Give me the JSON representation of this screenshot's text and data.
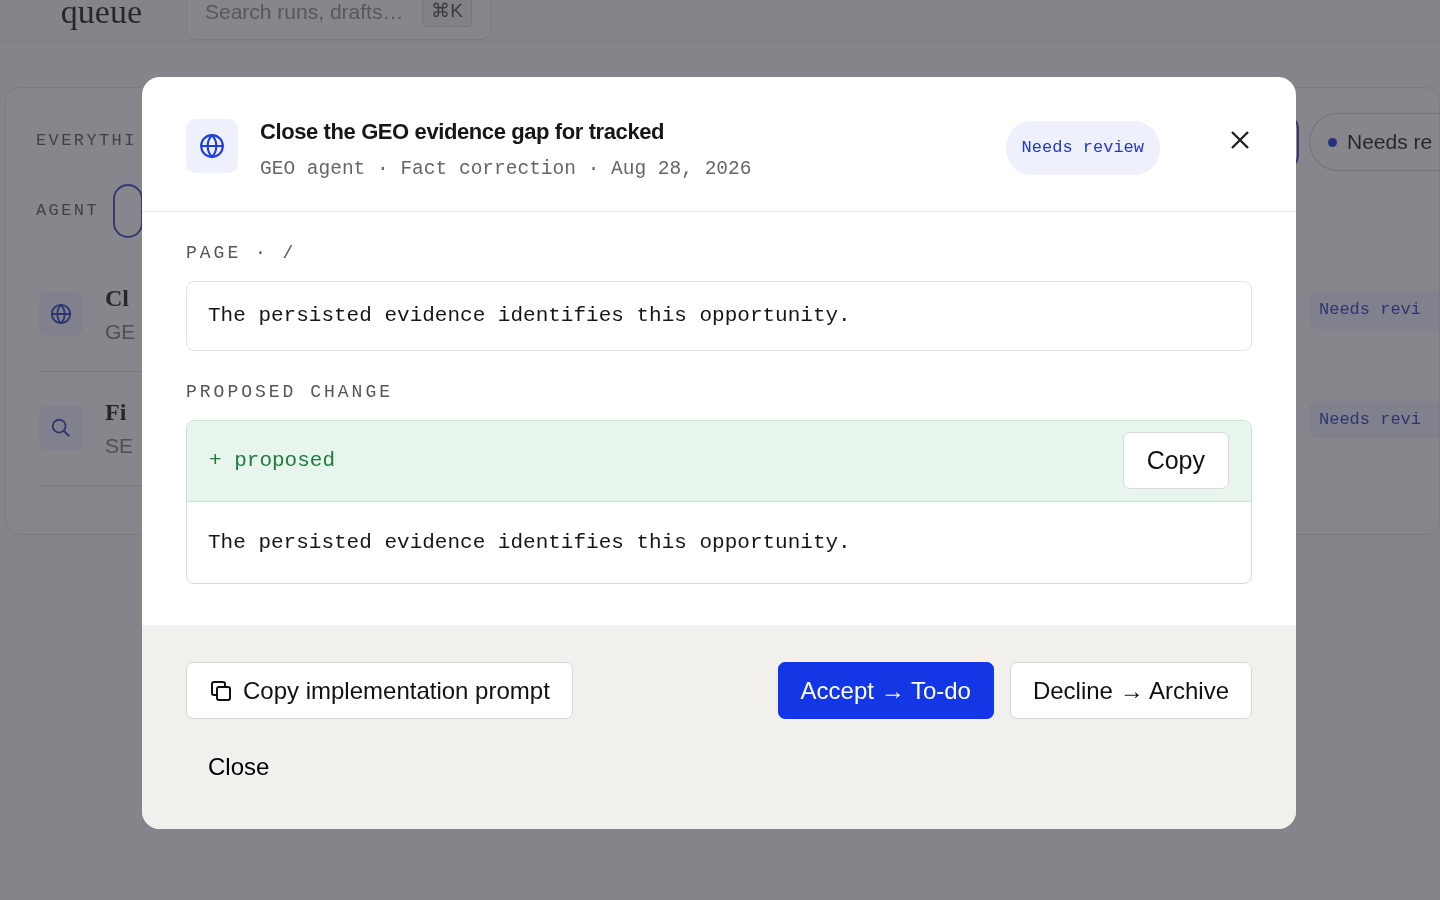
{
  "background": {
    "title": "queue",
    "search": {
      "placeholder": "Search runs, drafts…",
      "shortcut": "⌘K"
    },
    "sections": [
      {
        "label": "EVERYTHI"
      },
      {
        "label": "AGENT"
      }
    ],
    "filter_chip": "Needs re",
    "rows": [
      {
        "title": "Cl",
        "subtitle": "GE",
        "status": "Needs revi"
      },
      {
        "title": "Fi",
        "subtitle": "SE",
        "status": "Needs revi"
      }
    ]
  },
  "dialog": {
    "title": "Close the GEO evidence gap for tracked",
    "meta": "GEO agent · Fact correction · Aug 28, 2026",
    "status": "Needs review",
    "page_label": "PAGE · /",
    "current_text": "The persisted evidence identifies this opportunity.",
    "proposed_label": "PROPOSED CHANGE",
    "diff_line": "+ proposed",
    "copy_button": "Copy",
    "proposed_text": "The persisted evidence identifies this opportunity.",
    "actions": [
      {
        "label": "Copy implementation prompt",
        "kind": "secondary"
      },
      {
        "label": "Accept → To-do",
        "kind": "primary"
      },
      {
        "label": "Decline → Archive",
        "kind": "secondary"
      },
      {
        "label": "Close",
        "kind": "link"
      }
    ]
  }
}
